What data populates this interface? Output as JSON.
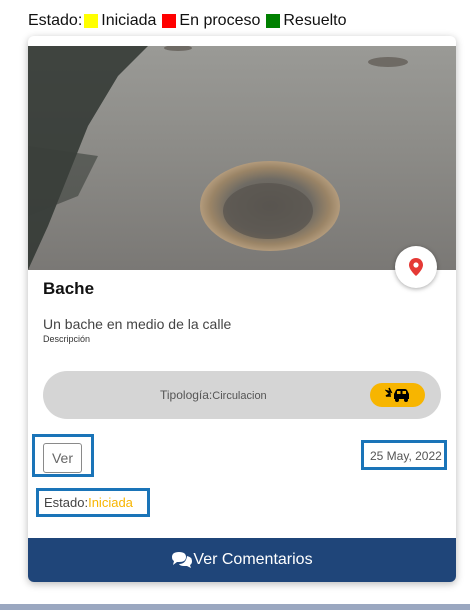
{
  "legend": {
    "prefix": "Estado:",
    "items": [
      {
        "label": "Iniciada",
        "color": "#ffff00"
      },
      {
        "label": "En proceso",
        "color": "#ff0000"
      },
      {
        "label": "Resuelto",
        "color": "#008000"
      }
    ]
  },
  "card": {
    "title": "Bache",
    "description": "Un bache en medio de la calle",
    "description_caption": "Descripción",
    "tipologia_label": "Tipología:",
    "tipologia_value": "Circulacion",
    "tipologia_icon": "car-crash-icon",
    "ver_label": "Ver",
    "date": "25 May, 2022",
    "estado_label": "Estado:",
    "estado_value": "Iniciada",
    "estado_color": "#f7b500",
    "map_icon": "map-pin-icon",
    "footer_label": "Ver Comentarios",
    "footer_icon": "comments-icon"
  }
}
